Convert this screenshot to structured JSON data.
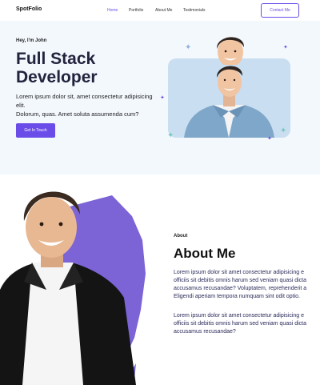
{
  "nav": {
    "brand": "SpotFolio",
    "links": [
      "Home",
      "Portfolio",
      "About Me",
      "Testimonials"
    ],
    "contact_label": "Contact Me"
  },
  "hero": {
    "greeting": "Hey, I'm John",
    "title": "Full Stack Developer",
    "description_line1": "Lorem ipsum dolor sit, amet consectetur adipisicing elit.",
    "description_line2": "Dolorum, quas. Amet soluta assumenda cum?",
    "cta_label": "Get In Touch"
  },
  "about": {
    "label": "About",
    "title": "About Me",
    "p1_lines": [
      "Lorem ipsum dolor sit amet consectetur adipisicing e",
      "officiis sit debitis omnis harum sed veniam quasi dicta",
      "accusamus recusandae? Voluptatem, reprehenderit a",
      "Eligendi aperiam tempora numquam sint odit optio."
    ],
    "p2_lines": [
      "Lorem ipsum dolor sit amet consectetur adipisicing e",
      "officiis sit debitis omnis harum sed veniam quasi dicta",
      "accusamus recusandae?"
    ]
  },
  "colors": {
    "accent": "#6a4de8",
    "hero_bg": "#f3f8fd",
    "photo_bg": "#c9def0"
  }
}
